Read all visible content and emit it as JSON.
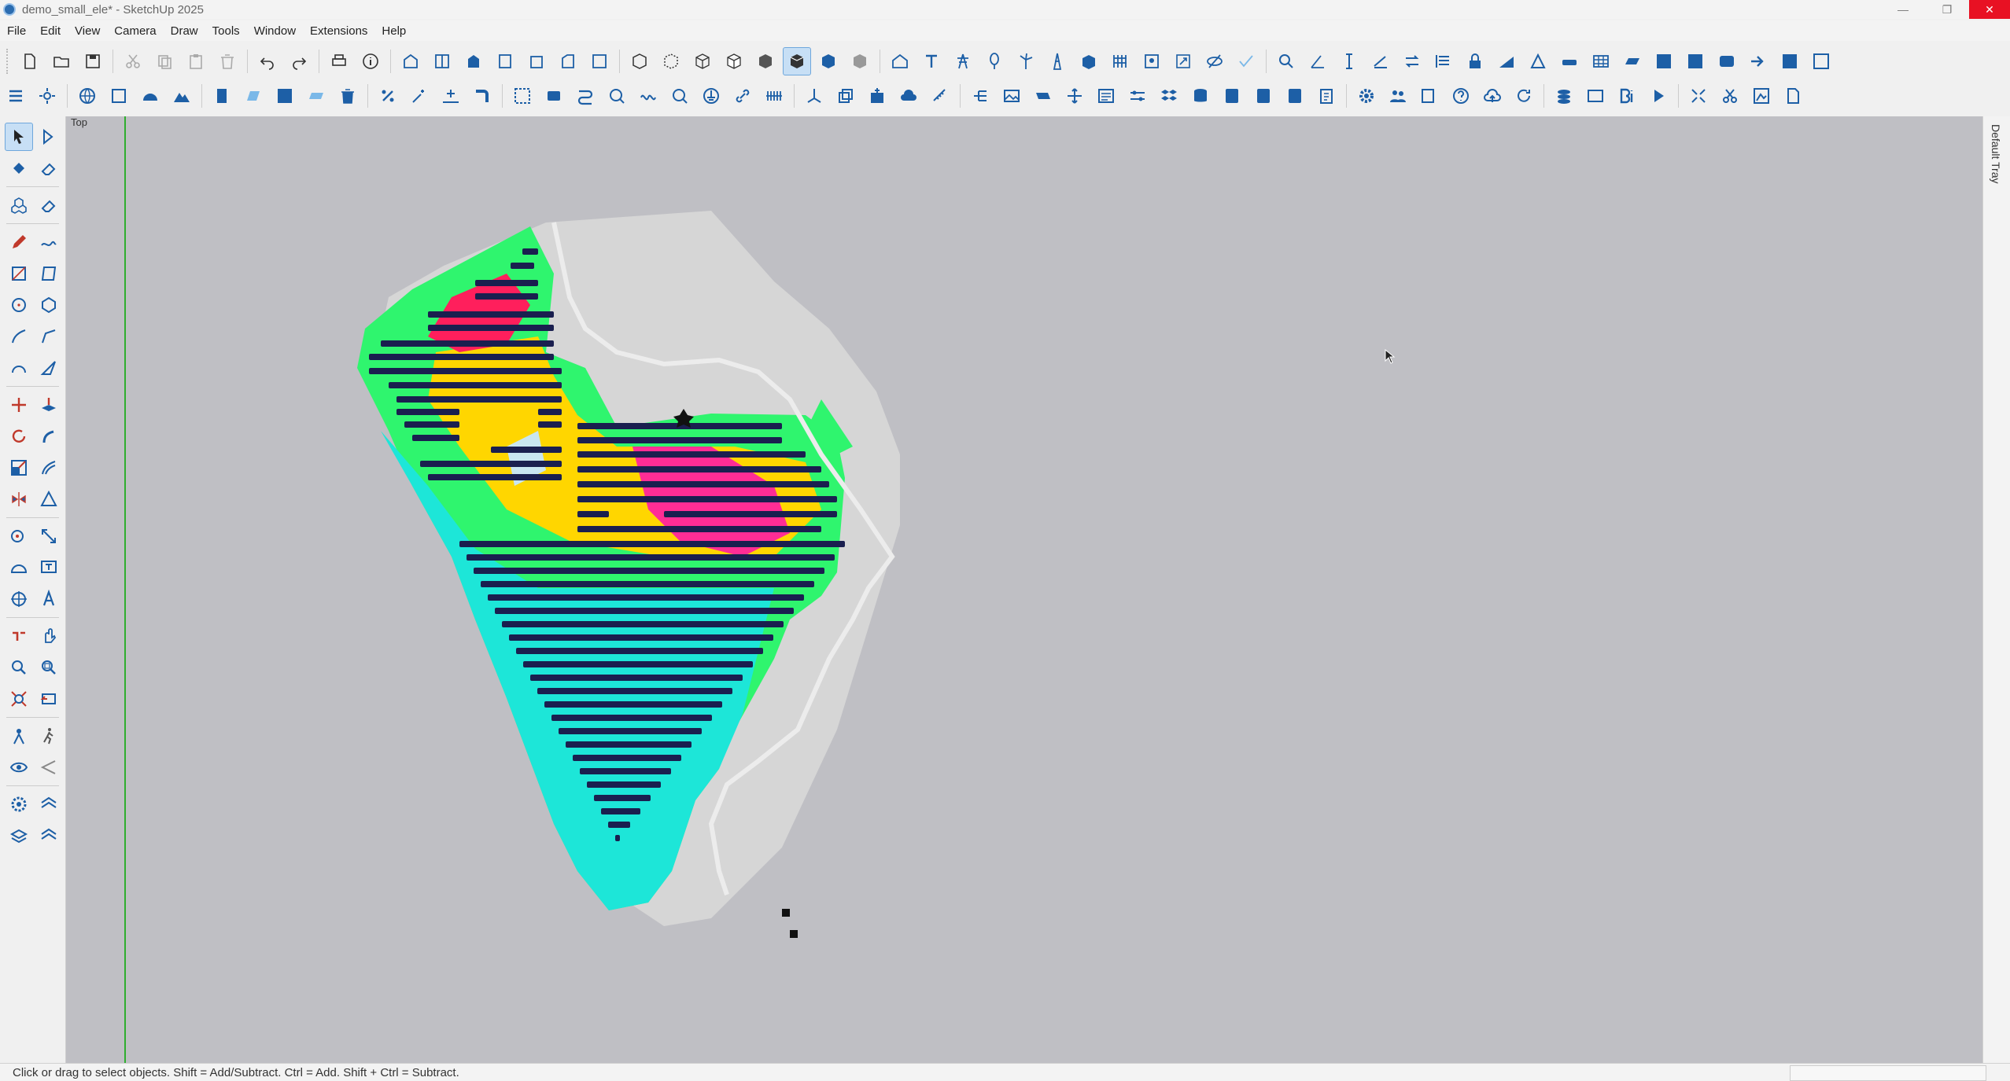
{
  "window": {
    "title": "demo_small_ele* - SketchUp 2025"
  },
  "menu": [
    "File",
    "Edit",
    "View",
    "Camera",
    "Draw",
    "Tools",
    "Window",
    "Extensions",
    "Help"
  ],
  "viewport": {
    "scene_label": "Top"
  },
  "tray": {
    "label": "Default Tray"
  },
  "status": {
    "text": "Click or drag to select objects. Shift = Add/Subtract. Ctrl = Add. Shift + Ctrl = Subtract."
  },
  "colors": {
    "accent": "#0a63b8",
    "viewport": "#bfbfc4",
    "axis_green": "#2fae2f",
    "panel": "#1a1f4f"
  }
}
